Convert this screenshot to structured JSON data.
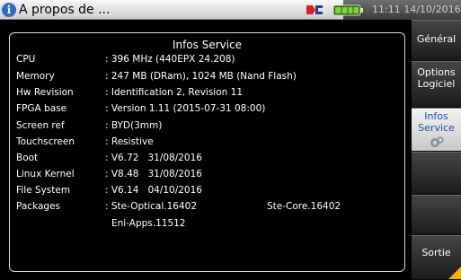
{
  "titlebar": {
    "title": "A propos de ...",
    "clock": "11:11 14/10/2016"
  },
  "panel": {
    "title": "Infos Service",
    "rows": [
      {
        "label": "CPU",
        "value": ": 396 MHz (440EPX 24.208)"
      },
      {
        "label": "Memory",
        "value": ": 247 MB (DRam), 1024 MB (Nand Flash)"
      },
      {
        "label": "Hw Revision",
        "value": ": Identification 2, Revision 11"
      },
      {
        "label": "FPGA base",
        "value": ": Version 1.11 (2015-07-31 08:00)"
      },
      {
        "label": "Screen ref",
        "value": ": BYD(3mm)"
      },
      {
        "label": "Touchscreen",
        "value": ": Resistive"
      },
      {
        "label": "Boot",
        "value": ": V6.72   31/08/2016"
      },
      {
        "label": "Linux Kernel",
        "value": ": V8.48   31/08/2016"
      },
      {
        "label": "File System",
        "value": ": V6.14   04/10/2016"
      },
      {
        "label": "Packages",
        "value": ": Ste-Optical.16402",
        "value2": "Ste-Core.16402"
      }
    ],
    "packages_extra": "Eni-Apps.11512"
  },
  "sidebar": {
    "general": "Général",
    "options_line1": "Options",
    "options_line2": "Logiciel",
    "infos_line1": "Infos",
    "infos_line2": "Service",
    "empty1": "",
    "empty2": "",
    "exit": "Sortie"
  },
  "icons": {
    "title": "info-icon",
    "logo": "brand-logo-icon",
    "battery": "battery-icon",
    "settings": "gear-icon"
  },
  "colors": {
    "info_icon": "#2a6ec9",
    "battery": "#7cd43c",
    "accent_text": "#1c4fa8",
    "corner": "#f0b400"
  }
}
